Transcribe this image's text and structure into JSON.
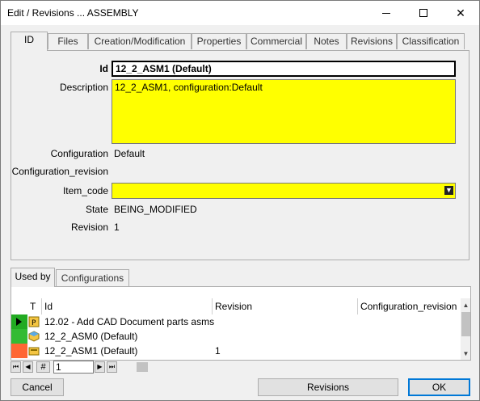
{
  "window": {
    "title": "Edit / Revisions ... ASSEMBLY"
  },
  "tabs": [
    "ID",
    "Files",
    "Creation/Modification",
    "Properties",
    "Commercial",
    "Notes",
    "Revisions",
    "Classification"
  ],
  "form": {
    "id_label": "Id",
    "id_value": "12_2_ASM1 (Default)",
    "description_label": "Description",
    "description_value": "12_2_ASM1, configuration:Default",
    "configuration_label": "Configuration",
    "configuration_value": "Default",
    "configuration_revision_label": "Configuration_revision",
    "item_code_label": "Item_code",
    "item_code_value": "",
    "state_label": "State",
    "state_value": "BEING_MODIFIED",
    "revision_label": "Revision",
    "revision_value": "1"
  },
  "lower_tabs": [
    "Used by",
    "Configurations"
  ],
  "grid": {
    "columns": [
      "T",
      "Id",
      "Revision",
      "Configuration_revision"
    ],
    "rows": [
      {
        "id": "12.02 - Add CAD Document parts asms",
        "revision": "",
        "config_revision": "",
        "status": "active",
        "indicator_color": "#22aa22",
        "type_icon": "document-p-icon"
      },
      {
        "id": "12_2_ASM0 (Default)",
        "revision": "",
        "config_revision": "",
        "status": "ok",
        "indicator_color": "#33bb33",
        "type_icon": "assembly-icon"
      },
      {
        "id": "12_2_ASM1 (Default)",
        "revision": "1",
        "config_revision": "",
        "status": "warn",
        "indicator_color": "#ff6633",
        "type_icon": "part-icon"
      }
    ]
  },
  "navigator": {
    "hash": "#",
    "record": "1"
  },
  "buttons": {
    "cancel": "Cancel",
    "revisions": "Revisions",
    "ok": "OK"
  },
  "colors": {
    "required_field": "#ffff00",
    "ok_border": "#0078d7"
  }
}
